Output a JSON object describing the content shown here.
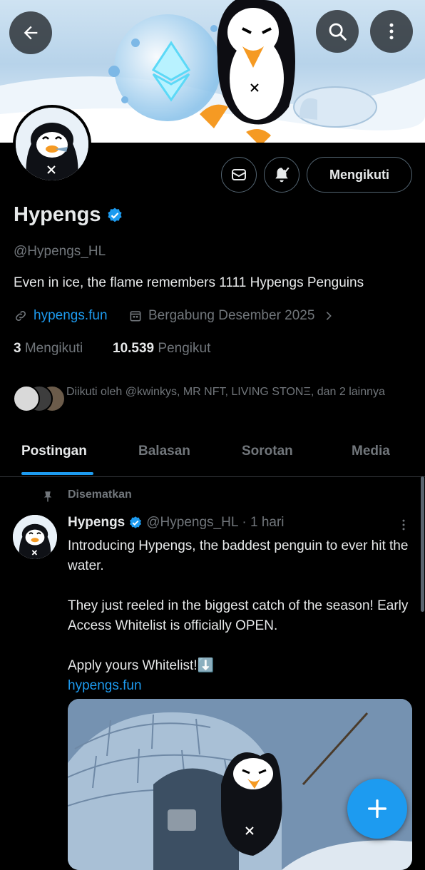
{
  "header": {
    "back_icon": "arrow-left-icon",
    "search_icon": "search-icon",
    "more_icon": "more-vertical-icon"
  },
  "profile": {
    "name": "Hypengs",
    "handle": "@Hypengs_HL",
    "bio": "Even in ice, the flame remembers  1111 Hypengs Penguins",
    "website": "hypengs.fun",
    "joined": "Bergabung Desember 2025",
    "following_count": "3",
    "following_label": "Mengikuti",
    "followers_count": "10.539",
    "followers_label": "Pengikut",
    "followed_by": "Diikuti oleh @kwinkys, MR NFT, LIVING STONΞ, dan 2 lainnya",
    "follow_button": "Mengikuti"
  },
  "tabs": [
    {
      "label": "Postingan"
    },
    {
      "label": "Balasan"
    },
    {
      "label": "Sorotan"
    },
    {
      "label": "Media"
    }
  ],
  "post": {
    "pinned_label": "Disematkan",
    "author": "Hypengs",
    "handle": "@Hypengs_HL",
    "time": "· 1 hari",
    "line1": "Introducing Hypengs, the baddest penguin to ever hit the water.",
    "line2": "They just reeled in the biggest catch of the season! Early Access Whitelist is officially OPEN.",
    "line3": "Apply yours Whitelist!⬇️",
    "link": "hypengs.fun"
  },
  "colors": {
    "accent": "#1d9bf0",
    "background": "#000000",
    "secondary_text": "#71767b",
    "primary_text": "#e7e9ea"
  }
}
